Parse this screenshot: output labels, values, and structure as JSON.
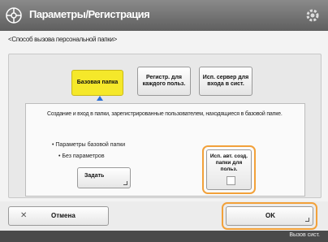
{
  "titlebar": {
    "title": "Параметры/Регистрация",
    "icon": "settings-wheel-icon",
    "right_icon": "gear-icon"
  },
  "subtitle": "<Способ вызова персональной папки>",
  "tabs": [
    {
      "label": "Базовая папка",
      "active": true
    },
    {
      "label": "Регистр. для каждого польз.",
      "active": false
    },
    {
      "label": "Исп. сервер для входа в сист.",
      "active": false
    }
  ],
  "description": "Создание и вход в папки, зарегистрированные пользователем, находящиеся в базовой папке.",
  "base_folder_label": "• Параметры базовой папки",
  "base_folder_value": "• Без параметров",
  "set_button": "Задать",
  "auto_create_label": "Исп. авт. созд. папки для польз.",
  "cancel_button": "Отмена",
  "ok_button": "OK",
  "status_text": "Вызов сист.",
  "colors": {
    "active_tab": "#f5e82a",
    "highlight": "#f2a13a",
    "arrow": "#2a6fd6"
  }
}
